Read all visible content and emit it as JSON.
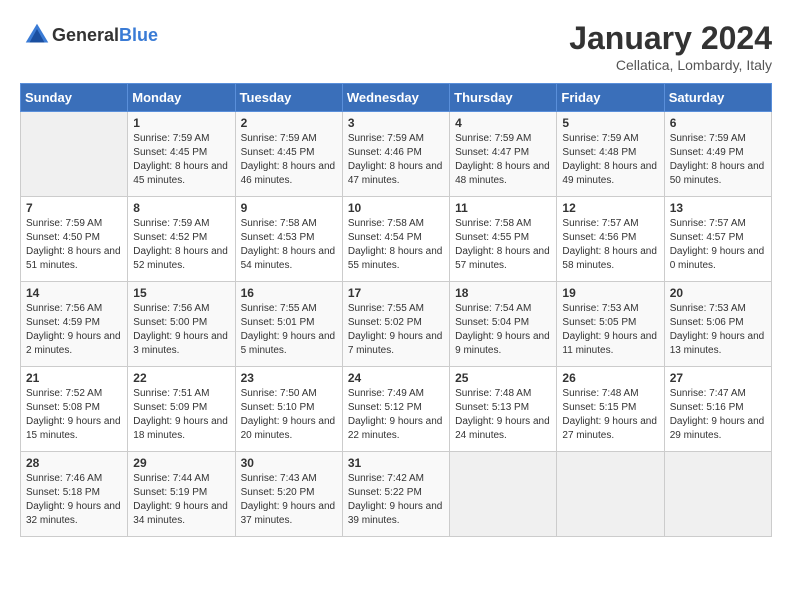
{
  "header": {
    "logo_general": "General",
    "logo_blue": "Blue",
    "month_title": "January 2024",
    "location": "Cellatica, Lombardy, Italy"
  },
  "weekdays": [
    "Sunday",
    "Monday",
    "Tuesday",
    "Wednesday",
    "Thursday",
    "Friday",
    "Saturday"
  ],
  "weeks": [
    [
      {
        "day": "",
        "sunrise": "",
        "sunset": "",
        "daylight": "",
        "empty": true
      },
      {
        "day": "1",
        "sunrise": "Sunrise: 7:59 AM",
        "sunset": "Sunset: 4:45 PM",
        "daylight": "Daylight: 8 hours and 45 minutes."
      },
      {
        "day": "2",
        "sunrise": "Sunrise: 7:59 AM",
        "sunset": "Sunset: 4:45 PM",
        "daylight": "Daylight: 8 hours and 46 minutes."
      },
      {
        "day": "3",
        "sunrise": "Sunrise: 7:59 AM",
        "sunset": "Sunset: 4:46 PM",
        "daylight": "Daylight: 8 hours and 47 minutes."
      },
      {
        "day": "4",
        "sunrise": "Sunrise: 7:59 AM",
        "sunset": "Sunset: 4:47 PM",
        "daylight": "Daylight: 8 hours and 48 minutes."
      },
      {
        "day": "5",
        "sunrise": "Sunrise: 7:59 AM",
        "sunset": "Sunset: 4:48 PM",
        "daylight": "Daylight: 8 hours and 49 minutes."
      },
      {
        "day": "6",
        "sunrise": "Sunrise: 7:59 AM",
        "sunset": "Sunset: 4:49 PM",
        "daylight": "Daylight: 8 hours and 50 minutes."
      }
    ],
    [
      {
        "day": "7",
        "sunrise": "Sunrise: 7:59 AM",
        "sunset": "Sunset: 4:50 PM",
        "daylight": "Daylight: 8 hours and 51 minutes."
      },
      {
        "day": "8",
        "sunrise": "Sunrise: 7:59 AM",
        "sunset": "Sunset: 4:52 PM",
        "daylight": "Daylight: 8 hours and 52 minutes."
      },
      {
        "day": "9",
        "sunrise": "Sunrise: 7:58 AM",
        "sunset": "Sunset: 4:53 PM",
        "daylight": "Daylight: 8 hours and 54 minutes."
      },
      {
        "day": "10",
        "sunrise": "Sunrise: 7:58 AM",
        "sunset": "Sunset: 4:54 PM",
        "daylight": "Daylight: 8 hours and 55 minutes."
      },
      {
        "day": "11",
        "sunrise": "Sunrise: 7:58 AM",
        "sunset": "Sunset: 4:55 PM",
        "daylight": "Daylight: 8 hours and 57 minutes."
      },
      {
        "day": "12",
        "sunrise": "Sunrise: 7:57 AM",
        "sunset": "Sunset: 4:56 PM",
        "daylight": "Daylight: 8 hours and 58 minutes."
      },
      {
        "day": "13",
        "sunrise": "Sunrise: 7:57 AM",
        "sunset": "Sunset: 4:57 PM",
        "daylight": "Daylight: 9 hours and 0 minutes."
      }
    ],
    [
      {
        "day": "14",
        "sunrise": "Sunrise: 7:56 AM",
        "sunset": "Sunset: 4:59 PM",
        "daylight": "Daylight: 9 hours and 2 minutes."
      },
      {
        "day": "15",
        "sunrise": "Sunrise: 7:56 AM",
        "sunset": "Sunset: 5:00 PM",
        "daylight": "Daylight: 9 hours and 3 minutes."
      },
      {
        "day": "16",
        "sunrise": "Sunrise: 7:55 AM",
        "sunset": "Sunset: 5:01 PM",
        "daylight": "Daylight: 9 hours and 5 minutes."
      },
      {
        "day": "17",
        "sunrise": "Sunrise: 7:55 AM",
        "sunset": "Sunset: 5:02 PM",
        "daylight": "Daylight: 9 hours and 7 minutes."
      },
      {
        "day": "18",
        "sunrise": "Sunrise: 7:54 AM",
        "sunset": "Sunset: 5:04 PM",
        "daylight": "Daylight: 9 hours and 9 minutes."
      },
      {
        "day": "19",
        "sunrise": "Sunrise: 7:53 AM",
        "sunset": "Sunset: 5:05 PM",
        "daylight": "Daylight: 9 hours and 11 minutes."
      },
      {
        "day": "20",
        "sunrise": "Sunrise: 7:53 AM",
        "sunset": "Sunset: 5:06 PM",
        "daylight": "Daylight: 9 hours and 13 minutes."
      }
    ],
    [
      {
        "day": "21",
        "sunrise": "Sunrise: 7:52 AM",
        "sunset": "Sunset: 5:08 PM",
        "daylight": "Daylight: 9 hours and 15 minutes."
      },
      {
        "day": "22",
        "sunrise": "Sunrise: 7:51 AM",
        "sunset": "Sunset: 5:09 PM",
        "daylight": "Daylight: 9 hours and 18 minutes."
      },
      {
        "day": "23",
        "sunrise": "Sunrise: 7:50 AM",
        "sunset": "Sunset: 5:10 PM",
        "daylight": "Daylight: 9 hours and 20 minutes."
      },
      {
        "day": "24",
        "sunrise": "Sunrise: 7:49 AM",
        "sunset": "Sunset: 5:12 PM",
        "daylight": "Daylight: 9 hours and 22 minutes."
      },
      {
        "day": "25",
        "sunrise": "Sunrise: 7:48 AM",
        "sunset": "Sunset: 5:13 PM",
        "daylight": "Daylight: 9 hours and 24 minutes."
      },
      {
        "day": "26",
        "sunrise": "Sunrise: 7:48 AM",
        "sunset": "Sunset: 5:15 PM",
        "daylight": "Daylight: 9 hours and 27 minutes."
      },
      {
        "day": "27",
        "sunrise": "Sunrise: 7:47 AM",
        "sunset": "Sunset: 5:16 PM",
        "daylight": "Daylight: 9 hours and 29 minutes."
      }
    ],
    [
      {
        "day": "28",
        "sunrise": "Sunrise: 7:46 AM",
        "sunset": "Sunset: 5:18 PM",
        "daylight": "Daylight: 9 hours and 32 minutes."
      },
      {
        "day": "29",
        "sunrise": "Sunrise: 7:44 AM",
        "sunset": "Sunset: 5:19 PM",
        "daylight": "Daylight: 9 hours and 34 minutes."
      },
      {
        "day": "30",
        "sunrise": "Sunrise: 7:43 AM",
        "sunset": "Sunset: 5:20 PM",
        "daylight": "Daylight: 9 hours and 37 minutes."
      },
      {
        "day": "31",
        "sunrise": "Sunrise: 7:42 AM",
        "sunset": "Sunset: 5:22 PM",
        "daylight": "Daylight: 9 hours and 39 minutes."
      },
      {
        "day": "",
        "sunrise": "",
        "sunset": "",
        "daylight": "",
        "empty": true
      },
      {
        "day": "",
        "sunrise": "",
        "sunset": "",
        "daylight": "",
        "empty": true
      },
      {
        "day": "",
        "sunrise": "",
        "sunset": "",
        "daylight": "",
        "empty": true
      }
    ]
  ]
}
